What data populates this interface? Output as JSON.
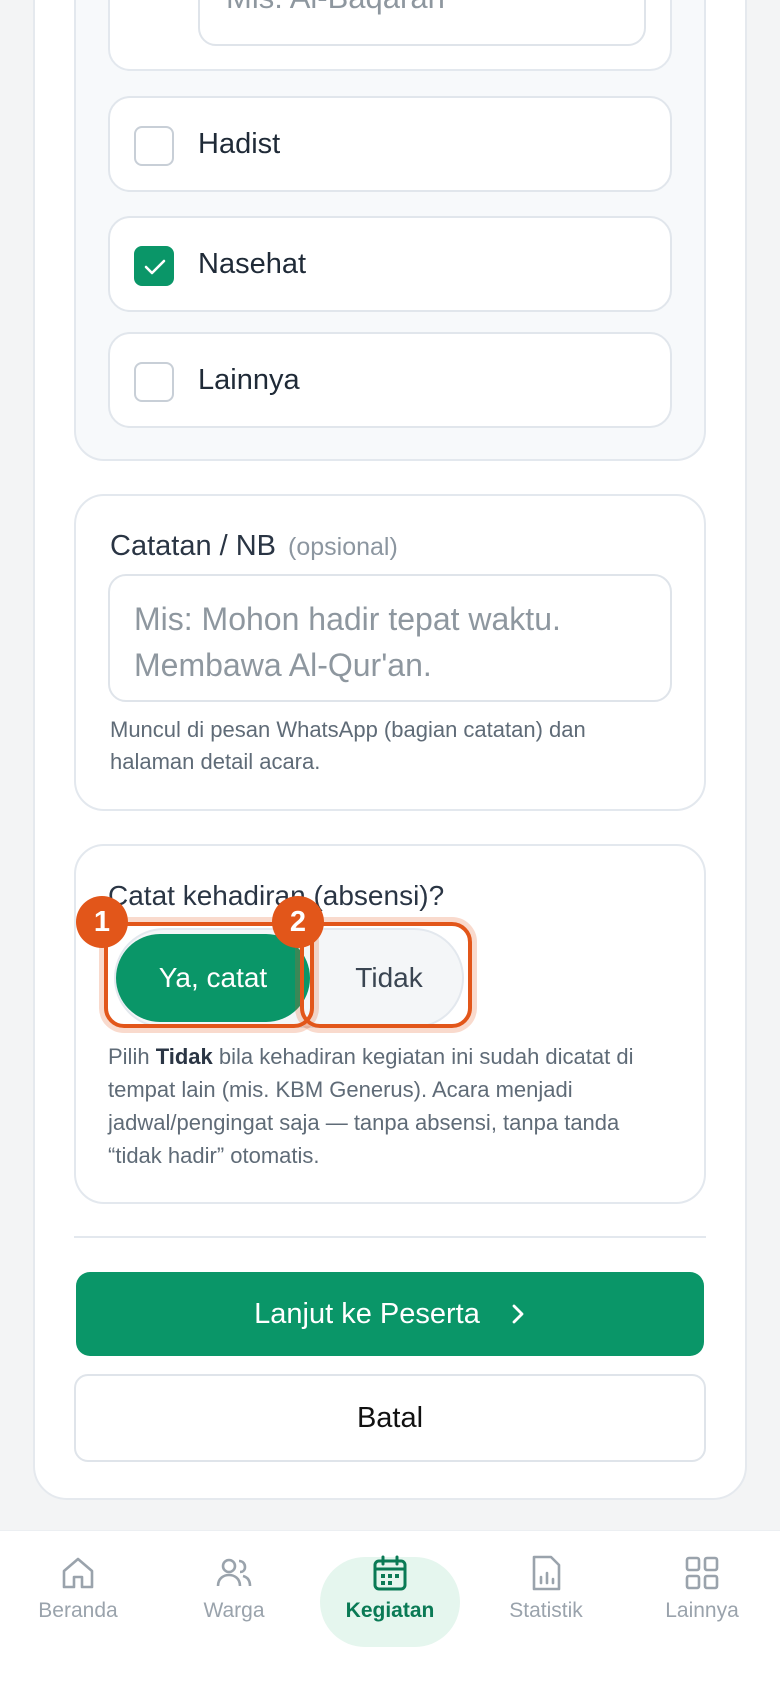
{
  "form": {
    "top_input_placeholder": "Mis: Al-Baqarah",
    "options": [
      {
        "label": "Hadist",
        "checked": false
      },
      {
        "label": "Nasehat",
        "checked": true
      },
      {
        "label": "Lainnya",
        "checked": false
      }
    ],
    "notes": {
      "title": "Catatan / NB",
      "optional_tag": "(opsional)",
      "placeholder_line1": "Mis: Mohon hadir tepat waktu.",
      "placeholder_line2": "Membawa Al-Qur'an.",
      "hint": "Muncul di pesan WhatsApp (bagian catatan) dan halaman detail acara."
    },
    "attendance": {
      "title": "Catat kehadiran (absensi)?",
      "yes_label": "Ya, catat",
      "no_label": "Tidak",
      "hint_prefix": "Pilih ",
      "hint_bold": "Tidak",
      "hint_rest": " bila kehadiran kegiatan ini sudah dicatat di tempat lain (mis. KBM Generus). Acara menjadi jadwal/pengingat saja — tanpa absensi, tanpa tanda “tidak hadir” otomatis."
    },
    "annotations": [
      "1",
      "2"
    ],
    "continue_label": "Lanjut ke Peserta",
    "cancel_label": "Batal"
  },
  "nav": {
    "items": [
      {
        "label": "Beranda",
        "icon": "home-icon"
      },
      {
        "label": "Warga",
        "icon": "users-icon"
      },
      {
        "label": "Kegiatan",
        "icon": "calendar-icon",
        "active": true
      },
      {
        "label": "Statistik",
        "icon": "report-icon"
      },
      {
        "label": "Lainnya",
        "icon": "grid-icon"
      }
    ]
  },
  "colors": {
    "primary": "#0a9668",
    "annotation": "#e2561a",
    "active_nav_bg": "#e5f6ee"
  }
}
